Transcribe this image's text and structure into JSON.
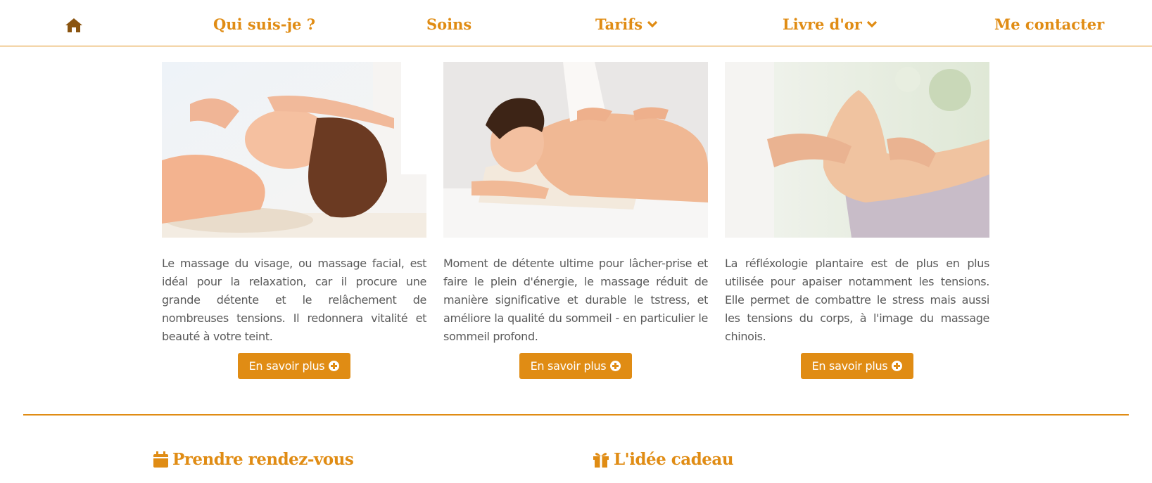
{
  "nav": {
    "home_icon": "home-icon",
    "items": [
      {
        "label": "Qui suis-je ?",
        "has_dropdown": false
      },
      {
        "label": "Soins",
        "has_dropdown": false
      },
      {
        "label": "Tarifs",
        "has_dropdown": true
      },
      {
        "label": "Livre d'or",
        "has_dropdown": true
      },
      {
        "label": "Me contacter",
        "has_dropdown": false
      }
    ]
  },
  "cards": [
    {
      "image": "massage-visage-photo",
      "text": "Le massage du visage, ou massage facial, est idéal pour la relaxation, car il procure une grande détente et le relâchement de nombreuses tensions. Il redonnera vitalité et beauté à votre teint.",
      "button_label": "En savoir plus"
    },
    {
      "image": "massage-dos-photo",
      "text": "Moment de détente ultime pour lâcher-prise et faire le plein d'énergie, le massage réduit de manière significative et durable le tstress, et améliore la qualité du sommeil - en particulier le sommeil profond.",
      "button_label": "En savoir plus"
    },
    {
      "image": "reflexologie-photo",
      "text": "La réfléxologie plantaire est de plus en plus utilisée pour apaiser notamment les tensions. Elle permet de combattre le stress mais aussi les tensions du corps, à l'image du massage chinois.",
      "button_label": "En savoir plus"
    }
  ],
  "sections": {
    "appointment": {
      "title": "Prendre rendez-vous",
      "icon": "calendar-icon"
    },
    "gift": {
      "title": "L'idée cadeau",
      "icon": "gift-icon"
    }
  },
  "colors": {
    "accent": "#e08c14",
    "text": "#5a5a5a",
    "background": "#ffffff"
  }
}
